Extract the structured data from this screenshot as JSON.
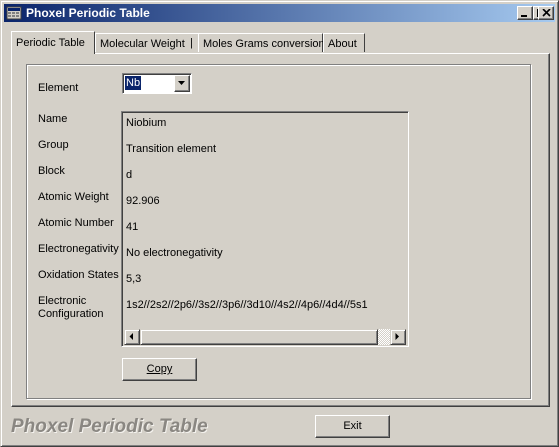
{
  "window": {
    "title": "Phoxel Periodic Table",
    "icon": "periodic-table-app-icon",
    "controls": [
      "minimize-icon",
      "maximize-icon",
      "close-icon"
    ]
  },
  "tabs": [
    {
      "label": "Periodic Table",
      "active": true
    },
    {
      "label": "Molecular Weight",
      "active": false
    },
    {
      "label": "Moles Grams conversion",
      "active": false
    },
    {
      "label": "About",
      "active": false
    }
  ],
  "tab_separator": "|",
  "element_selector": {
    "label": "Element",
    "value": "Nb"
  },
  "fields": [
    {
      "label": "Name",
      "value": "Niobium"
    },
    {
      "label": "Group",
      "value": "Transition element"
    },
    {
      "label": "Block",
      "value": "d"
    },
    {
      "label": "Atomic Weight",
      "value": "92.906"
    },
    {
      "label": "Atomic Number",
      "value": "41"
    },
    {
      "label": "Electronegativity",
      "value": "No electronegativity"
    },
    {
      "label": "Oxidation States",
      "value": "5,3"
    },
    {
      "label": "Electronic Configuration",
      "label_line1": "Electronic",
      "label_line2": "Configuration",
      "value": "1s2//2s2//2p6//3s2//3p6//3d10//4s2//4p6//4d4//5s1"
    }
  ],
  "buttons": {
    "copy": "Copy",
    "exit": "Exit"
  },
  "footer_title": "Phoxel Periodic Table",
  "colors": {
    "title_start": "#0a246a",
    "title_end": "#a6caf0",
    "face": "#d4d0c8",
    "selection": "#0a246a"
  }
}
